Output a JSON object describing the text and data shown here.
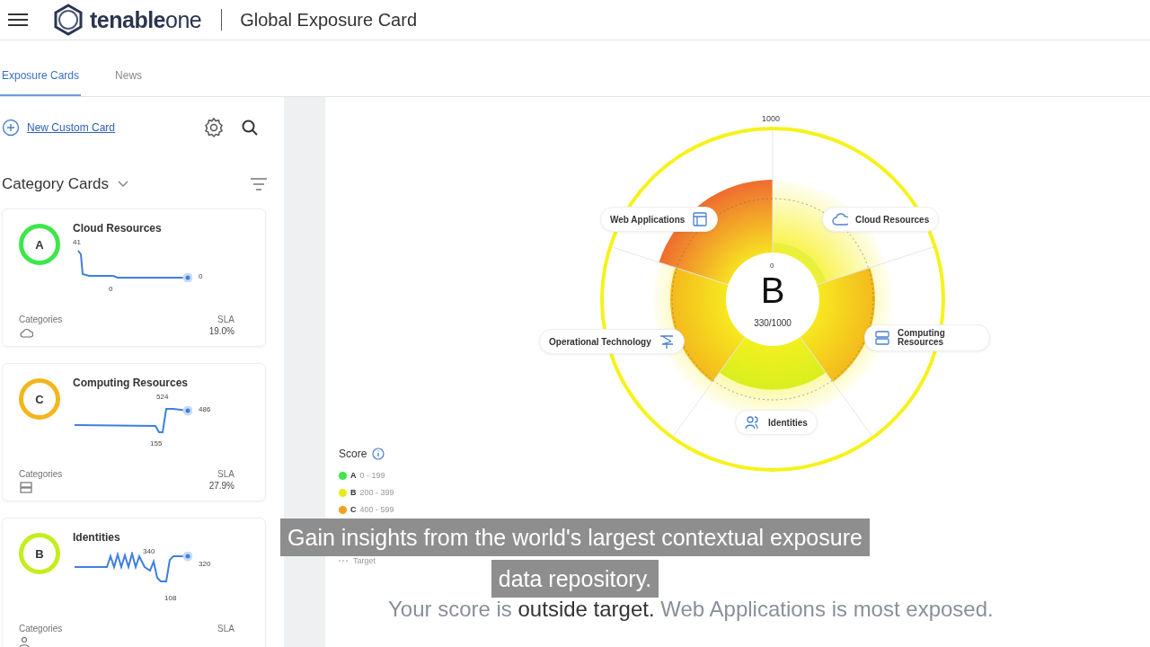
{
  "header": {
    "brand": "**tenable**one",
    "title": "Global Exposure Card"
  },
  "tabs": [
    {
      "label": "Exposure Cards",
      "selected": true
    },
    {
      "label": "News",
      "selected": false
    }
  ],
  "sidebar": {
    "new_card_link": "New Custom Card",
    "section_title": "Category Cards",
    "cards": [
      {
        "grade": "A",
        "color": "#3ee64a",
        "title": "Cloud Resources",
        "spark_labels": [
          "41",
          "0",
          "0"
        ],
        "categories_label": "Categories",
        "sla_label": "SLA",
        "sla_value": "19.0%"
      },
      {
        "grade": "C",
        "color": "#f2b61e",
        "title": "Computing Resources",
        "spark_labels": [
          "524",
          "155",
          "486"
        ],
        "categories_label": "Categories",
        "sla_label": "SLA",
        "sla_value": "27.9%"
      },
      {
        "grade": "B",
        "color": "#c4ee1c",
        "title": "Identities",
        "spark_labels": [
          "340",
          "108",
          "320"
        ],
        "categories_label": "Categories",
        "sla_label": "SLA"
      }
    ]
  },
  "wheel": {
    "max_label": "1000",
    "min_label": "0",
    "grade": "B",
    "score": "330/1000",
    "sectors": [
      {
        "label": "Cloud Resources"
      },
      {
        "label": "Computing Resources"
      },
      {
        "label": "Identities"
      },
      {
        "label": "Operational Technology"
      },
      {
        "label": "Web Applications"
      }
    ]
  },
  "legend": {
    "title": "Score",
    "items": [
      {
        "grade": "A",
        "range": "0 - 199",
        "color": "#3ee64a"
      },
      {
        "grade": "B",
        "range": "200 - 399",
        "color": "#e8e81c"
      },
      {
        "grade": "C",
        "range": "400 - 599",
        "color": "#f2a21c"
      }
    ],
    "target_label": "Target"
  },
  "message": "Your score is **outside target.** Web Applications is most exposed.",
  "caption": [
    "Gain insights from the world's largest contextual exposure",
    "data repository."
  ]
}
